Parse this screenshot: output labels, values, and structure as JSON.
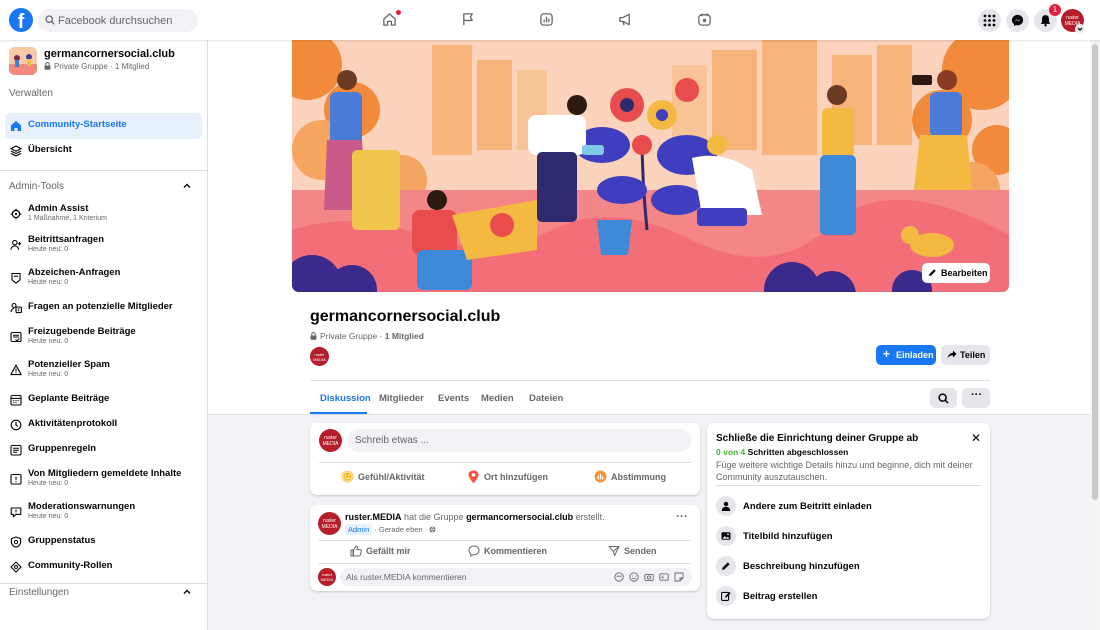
{
  "topbar": {
    "logo": "f",
    "search_placeholder": "Facebook durchsuchen",
    "notification_count": "1",
    "profile_avatar_text": "ruster MEDIA"
  },
  "sidebar": {
    "group_name": "germancornersocial.club",
    "group_meta": "Private Gruppe · 1 Mitglied",
    "manage_label": "Verwalten",
    "items_top": [
      {
        "label": "Community-Startseite",
        "icon": "home-icon",
        "active": true
      },
      {
        "label": "Übersicht",
        "icon": "layers-icon"
      }
    ],
    "admin_tools_label": "Admin-Tools",
    "admin_items": [
      {
        "label": "Admin Assist",
        "sub": "1 Maßnahme, 1 Kriterium",
        "icon": "gear-icon"
      },
      {
        "label": "Beitrittsanfragen",
        "sub": "Heute neu: 0",
        "icon": "add-person-icon"
      },
      {
        "label": "Abzeichen-Anfragen",
        "sub": "Heute neu: 0",
        "icon": "badge-icon"
      },
      {
        "label": "Fragen an potenzielle Mitglieder",
        "sub": "",
        "icon": "question-icon"
      },
      {
        "label": "Freizugebende Beiträge",
        "sub": "Heute neu: 0",
        "icon": "post-approval-icon"
      },
      {
        "label": "Potenzieller Spam",
        "sub": "Heute neu: 0",
        "icon": "warning-icon"
      },
      {
        "label": "Geplante Beiträge",
        "sub": "",
        "icon": "calendar-icon"
      },
      {
        "label": "Aktivitätenprotokoll",
        "sub": "",
        "icon": "activity-log-icon"
      },
      {
        "label": "Gruppenregeln",
        "sub": "",
        "icon": "rules-icon"
      },
      {
        "label": "Von Mitgliedern gemeldete Inhalte",
        "sub": "Heute neu: 0",
        "icon": "report-icon"
      },
      {
        "label": "Moderationswarnungen",
        "sub": "Heute neu: 0",
        "icon": "moderation-icon"
      },
      {
        "label": "Gruppenstatus",
        "sub": "",
        "icon": "shield-icon"
      },
      {
        "label": "Community-Rollen",
        "sub": "",
        "icon": "roles-icon"
      }
    ],
    "settings_label": "Einstellungen"
  },
  "cover": {
    "edit_label": "Bearbeiten"
  },
  "header": {
    "title": "germancornersocial.club",
    "meta_prefix": "Private Gruppe · ",
    "meta_members": "1 Mitglied",
    "avatar_text": "ruster MEDIA",
    "invite_label": "Einladen",
    "share_label": "Teilen",
    "tabs": [
      "Diskussion",
      "Mitglieder",
      "Events",
      "Medien",
      "Dateien"
    ],
    "more_label": "···"
  },
  "composer": {
    "placeholder": "Schreib etwas ...",
    "actions": [
      "Gefühl/Aktivität",
      "Ort hinzufügen",
      "Abstimmung"
    ]
  },
  "post": {
    "author": "ruster.MEDIA",
    "action_text": " hat die Gruppe ",
    "group": "germancornersocial.club",
    "action_suffix": " erstellt.",
    "badge": "Admin",
    "time": " · Gerade eben · ",
    "more": "···",
    "actions": [
      "Gefällt mir",
      "Kommentieren",
      "Senden"
    ],
    "comment_placeholder": "Als ruster.MEDIA kommentieren"
  },
  "setup": {
    "title": "Schließe die Einrichtung deiner Gruppe ab",
    "close": "✕",
    "progress_done": "0 von 4",
    "progress_rest": " Schritten abgeschlossen",
    "description": "Füge weitere wichtige Details hinzu und beginne, dich mit deiner Community auszutauschen.",
    "items": [
      {
        "label": "Andere zum Beitritt einladen",
        "icon": "person-icon"
      },
      {
        "label": "Titelbild hinzufügen",
        "icon": "image-icon"
      },
      {
        "label": "Beschreibung hinzufügen",
        "icon": "pencil-icon"
      },
      {
        "label": "Beitrag erstellen",
        "icon": "edit-post-icon"
      }
    ]
  },
  "colors": {
    "brand": "#1877f2",
    "active_bg": "#e7f0fd",
    "progress_green": "#42b72a",
    "notification_red": "#e41e3f",
    "avatar_red": "#b51d2a"
  }
}
